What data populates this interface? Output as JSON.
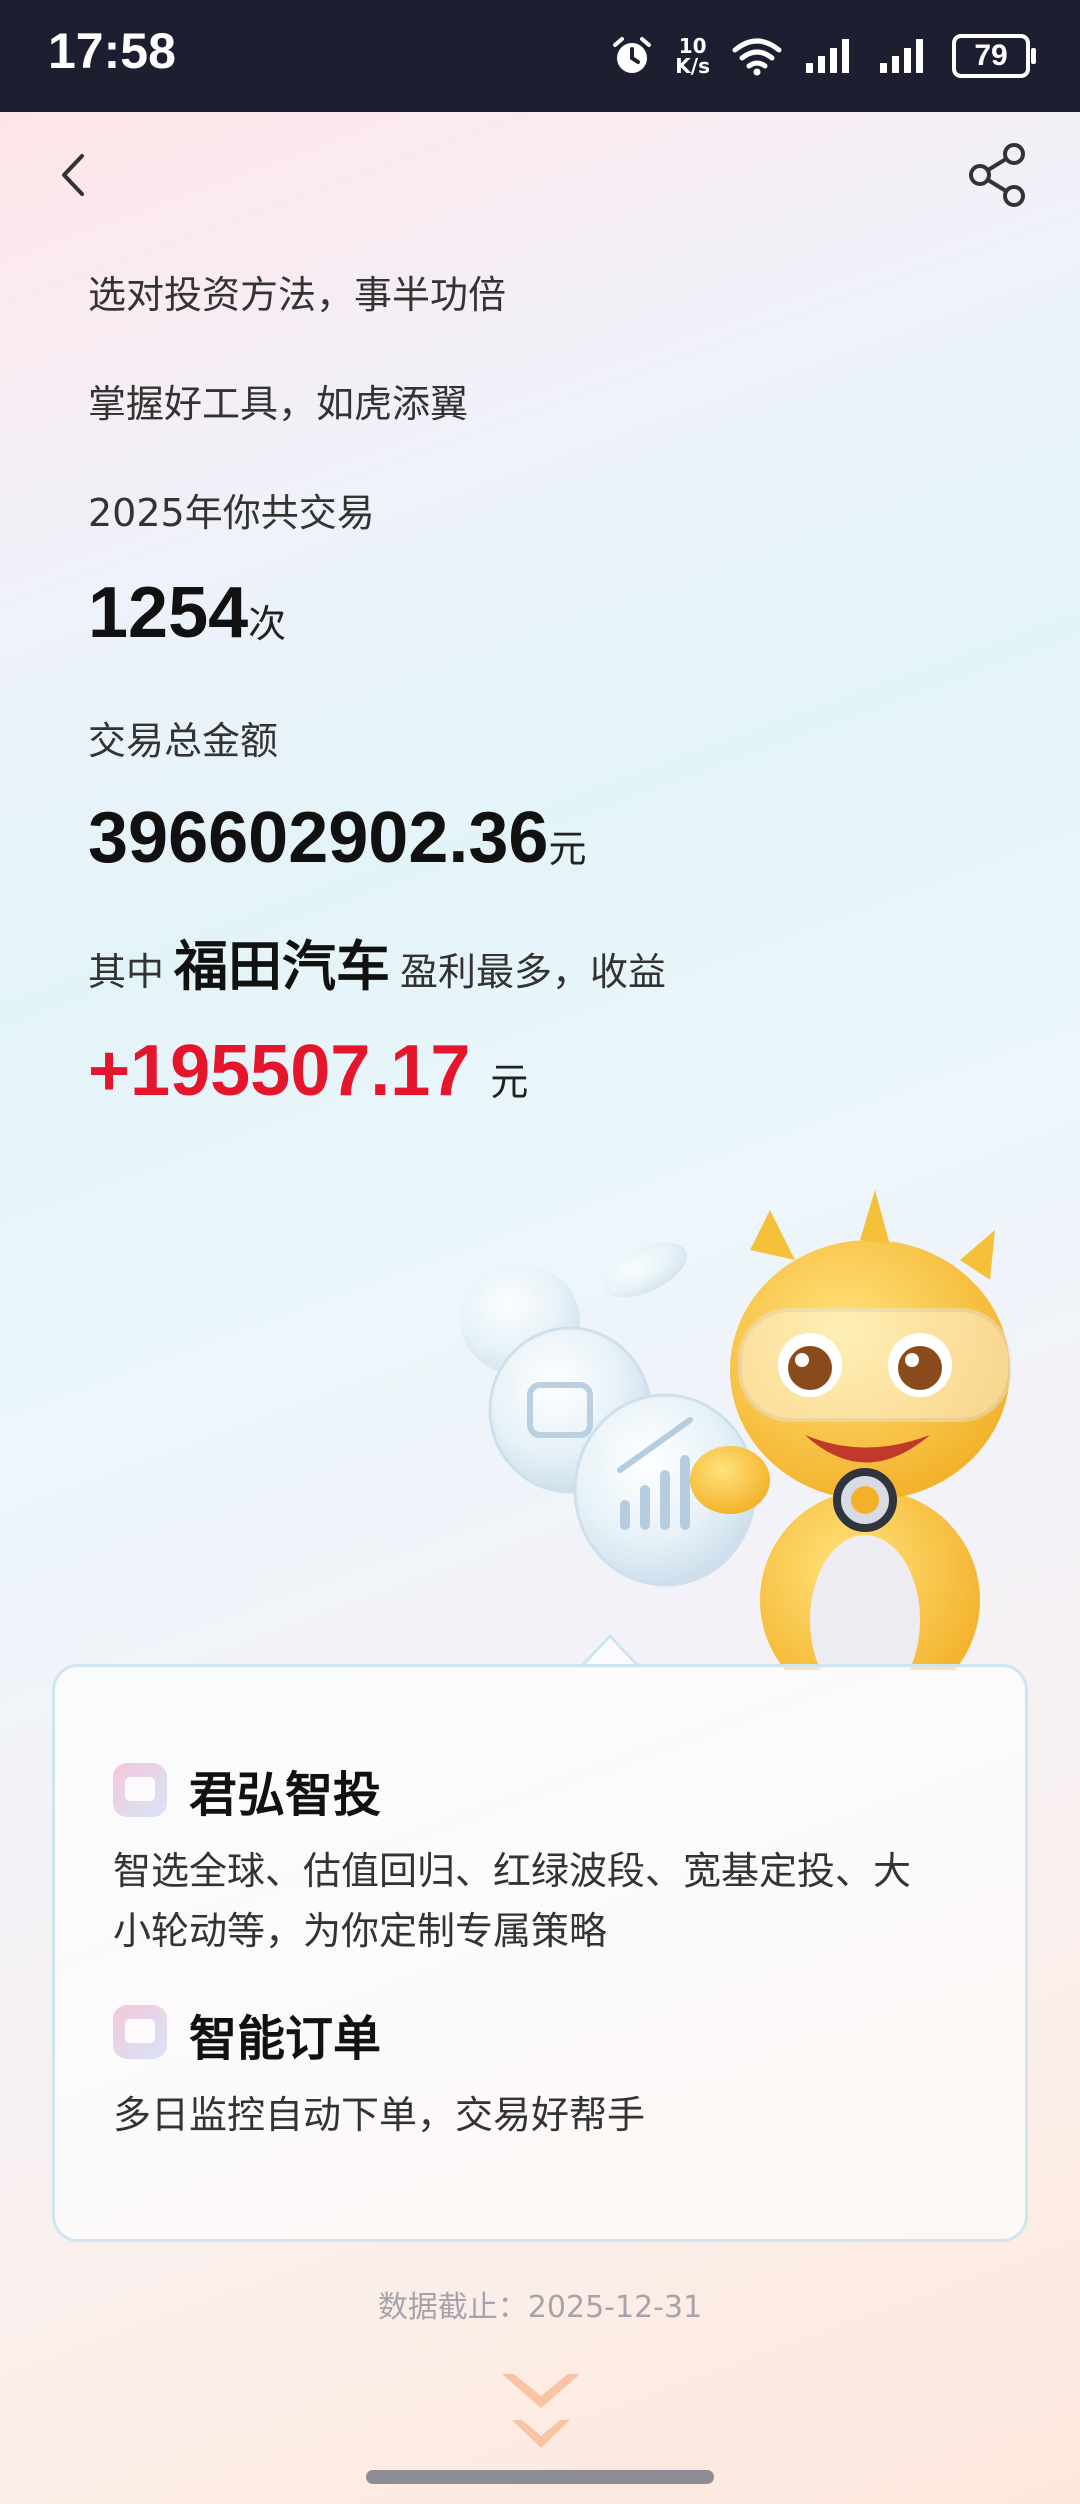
{
  "status_bar": {
    "time": "17:58",
    "net_speed_value": "10",
    "net_speed_unit": "K/s",
    "battery": "79"
  },
  "nav": {
    "back_icon": "chevron-left-icon",
    "share_icon": "share-icon"
  },
  "summary": {
    "line1": "选对投资方法，事半功倍",
    "line2": "掌握好工具，如虎添翼",
    "trades_label": "2025年你共交易",
    "trades_count": "1254",
    "trades_unit": "次",
    "amount_label": "交易总金额",
    "amount_value": "396602902.36",
    "amount_unit": "元",
    "best_prefix": "其中",
    "best_stock": "福田汽车",
    "best_suffix": "盈利最多，收益",
    "profit_value": "+195507.17",
    "profit_unit": "元"
  },
  "features": [
    {
      "title": "君弘智投",
      "desc_line1": "智选全球、估值回归、红绿波段、宽基定投、大",
      "desc_line2": "小轮动等，为你定制专属策略"
    },
    {
      "title": "智能订单",
      "desc_line1": "多日监控自动下单，交易好帮手"
    }
  ],
  "footer": {
    "date_note": "数据截止：2025-12-31"
  },
  "colors": {
    "profit": "#e5162c",
    "status_bg": "#1d1f30"
  }
}
